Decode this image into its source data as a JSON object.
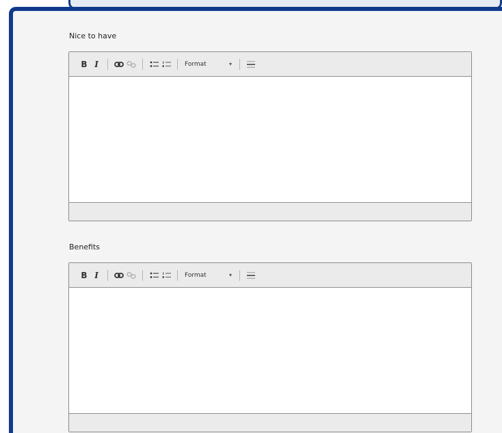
{
  "fields": [
    {
      "label": "Nice to have",
      "toolbar": {
        "bold": "B",
        "italic": "I",
        "format_label": "Format",
        "format_arrow": "▾"
      },
      "content": ""
    },
    {
      "label": "Benefits",
      "toolbar": {
        "bold": "B",
        "italic": "I",
        "format_label": "Format",
        "format_arrow": "▾"
      },
      "content": ""
    }
  ],
  "icons": [
    "link-icon",
    "unlink-icon",
    "bulleted-list-icon",
    "numbered-list-icon",
    "horizontal-rule-icon"
  ],
  "colors": {
    "frame_border": "#0f3a8c",
    "panel_bg": "#f4f4f5",
    "toolbar_bg": "#ebebeb"
  }
}
